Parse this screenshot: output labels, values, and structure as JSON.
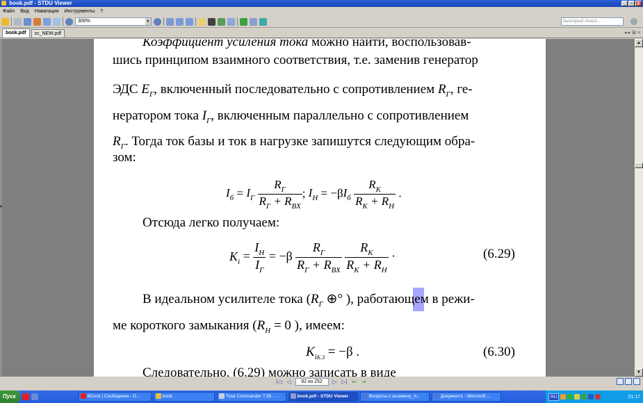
{
  "window": {
    "title": "book.pdf - STDU Viewer",
    "buttons": [
      "_",
      "▫",
      "x"
    ]
  },
  "menu": [
    "Файл",
    "Вид",
    "Навигация",
    "Инструменты",
    "?"
  ],
  "toolbar": {
    "zoom": "300%",
    "search_placeholder": "Быстрый поиск..."
  },
  "tabs": [
    {
      "label": "book.pdf",
      "active": true
    },
    {
      "label": "sc_NEW.pdf",
      "active": false
    }
  ],
  "doc": {
    "l1": "Коэффициент усиления тока",
    "l1b": " можно найти, воспользовав-",
    "l2": "шись принципом взаимного соответствия, т.е. заменив генератор",
    "l3a": "ЭДС ",
    "l3b": ", включенный последовательно с сопротивлением ",
    "l3c": ", ге-",
    "l4a": "нератором тока ",
    "l4b": ", включенным параллельно с сопротивлением",
    "l5": ". Тогда ток базы и ток в нагрузке запишутся следующим обра-",
    "l6": "зом:",
    "l7": "Отсюда легко получаем:",
    "eq629": "(6.29)",
    "l8a": "В идеальном усилителе тока (",
    "l8b": " ), работающем в режи-",
    "l9a": "ме короткого замыкания (",
    "l9b": " ), имеем:",
    "eq630": "(6.30)",
    "l10": "Следовательно, (6.29) можно записать в виде"
  },
  "pager": {
    "current": "92 из 252"
  },
  "taskbar": {
    "start": "Пуск",
    "tasks": [
      {
        "label": "ВСети | Сообщения - О...",
        "active": false
      },
      {
        "label": "book",
        "active": false
      },
      {
        "label": "Total Commander 7.55 - ...",
        "active": false
      },
      {
        "label": "book.pdf - STDU Viewer",
        "active": true
      },
      {
        "label": "Вопросы к экзамену_А...",
        "active": false
      },
      {
        "label": "Документ1 - Microsoft ...",
        "active": false
      }
    ],
    "lang": "RU",
    "clock": "21:17"
  }
}
